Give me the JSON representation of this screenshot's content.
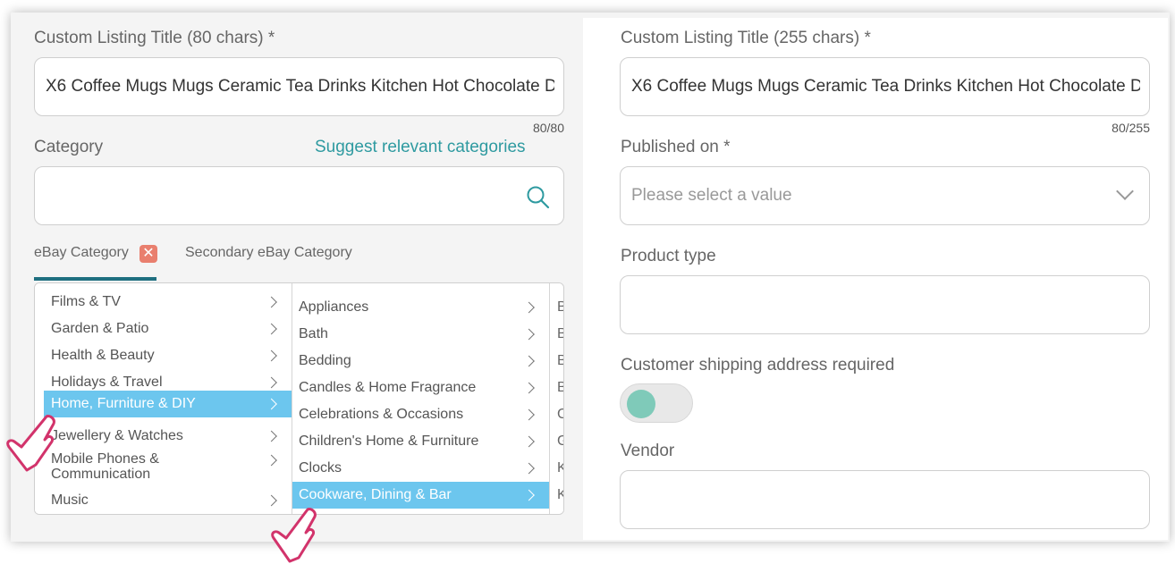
{
  "left": {
    "title_label": "Custom Listing Title (80 chars) *",
    "title_value": "X6 Coffee Mugs Mugs Ceramic Tea Drinks Kitchen Hot Chocolate D",
    "title_counter": "80/80",
    "category_label": "Category",
    "suggest_link": "Suggest relevant categories",
    "category_value": "",
    "tabs": {
      "ebay": "eBay Category",
      "secondary": "Secondary eBay Category"
    },
    "menu_col1": [
      {
        "label": "Films & TV"
      },
      {
        "label": "Garden & Patio"
      },
      {
        "label": "Health & Beauty"
      },
      {
        "label": "Holidays & Travel"
      },
      {
        "label": "Home, Furniture & DIY"
      },
      {
        "label": "Jewellery & Watches"
      },
      {
        "label": "Mobile Phones &"
      },
      {
        "label": "Communication"
      },
      {
        "label": "Music"
      }
    ],
    "menu_col2": [
      {
        "label": "Appliances"
      },
      {
        "label": "Bath"
      },
      {
        "label": "Bedding"
      },
      {
        "label": "Candles & Home Fragrance"
      },
      {
        "label": "Celebrations & Occasions"
      },
      {
        "label": "Children's Home & Furniture"
      },
      {
        "label": "Clocks"
      },
      {
        "label": "Cookware, Dining & Bar"
      }
    ],
    "menu_col3_letters": [
      "B",
      "B",
      "B",
      "B",
      "C",
      "G",
      "K",
      "K"
    ]
  },
  "right": {
    "title_label": "Custom Listing Title (255 chars) *",
    "title_value": "X6 Coffee Mugs Mugs Ceramic Tea Drinks Kitchen Hot Chocolate D",
    "title_counter": "80/255",
    "published_label": "Published on *",
    "published_placeholder": "Please select a value",
    "product_type_label": "Product type",
    "product_type_value": "",
    "shipping_label": "Customer shipping address required",
    "shipping_toggle_on": false,
    "vendor_label": "Vendor",
    "vendor_value": ""
  },
  "colors": {
    "accent": "#2e9aa0",
    "selected_item": "#6cc6ee",
    "tab_underline": "#1f6f80",
    "toggle_knob": "#7fcab9",
    "remove_badge": "#e97f6e",
    "cursor_outline": "#d2336b"
  },
  "icons": [
    "search-icon",
    "close-icon",
    "chevron-right-icon",
    "chevron-down-icon",
    "hand-cursor-icon"
  ]
}
